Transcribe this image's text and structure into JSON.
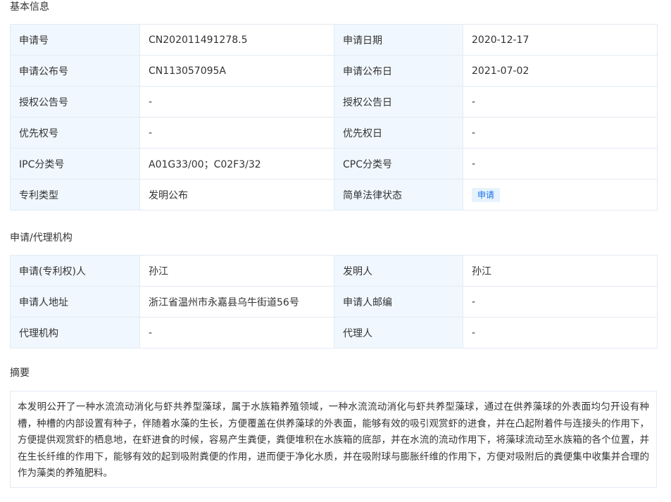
{
  "sections": {
    "basic": "基本信息",
    "agency": "申请/代理机构",
    "abstract": "摘要"
  },
  "basic_info": {
    "rows": [
      {
        "l1": "申请号",
        "v1": "CN202011491278.5",
        "l2": "申请日期",
        "v2": "2020-12-17"
      },
      {
        "l1": "申请公布号",
        "v1": "CN113057095A",
        "l2": "申请公布日",
        "v2": "2021-07-02"
      },
      {
        "l1": "授权公告号",
        "v1": "-",
        "l2": "授权公告日",
        "v2": "-"
      },
      {
        "l1": "优先权号",
        "v1": "-",
        "l2": "优先权日",
        "v2": "-"
      },
      {
        "l1": "IPC分类号",
        "v1": "A01G33/00；C02F3/32",
        "l2": "CPC分类号",
        "v2": "-"
      },
      {
        "l1": "专利类型",
        "v1": "发明公布",
        "l2": "简单法律状态",
        "v2": "申请"
      }
    ]
  },
  "agency_info": {
    "rows": [
      {
        "l1": "申请(专利权)人",
        "v1": "孙江",
        "l2": "发明人",
        "v2": "孙江"
      },
      {
        "l1": "申请人地址",
        "v1": "浙江省温州市永嘉县乌牛街道56号",
        "l2": "申请人邮编",
        "v2": "-"
      },
      {
        "l1": "代理机构",
        "v1": "-",
        "l2": "代理人",
        "v2": "-"
      }
    ]
  },
  "abstract_text": "本发明公开了一种水流流动消化与虾共养型藻球，属于水族箱养殖领域，一种水流流动消化与虾共养型藻球，通过在供养藻球的外表面均匀开设有种槽，种槽的内部设置有种子，伴随着水藻的生长，方便覆盖在供养藻球的外表面，能够有效的吸引观赏虾的进食，并在凸起附着件与连接头的作用下，方便提供观赏虾的栖息地，在虾进食的时候，容易产生粪便，粪便堆积在水族箱的底部，并在水流的流动作用下，将藻球流动至水族箱的各个位置，并在生长纤维的作用下，能够有效的起到吸附粪便的作用，进而便于净化水质，并在吸附球与膨胀纤维的作用下，方便对吸附后的粪便集中收集并合理的作为藻类的养殖肥料。",
  "colors": {
    "label_bg": "#f0f7fe",
    "border": "#e4ebf3",
    "badge_bg": "#e6f2fd",
    "badge_text": "#1a73e8"
  }
}
